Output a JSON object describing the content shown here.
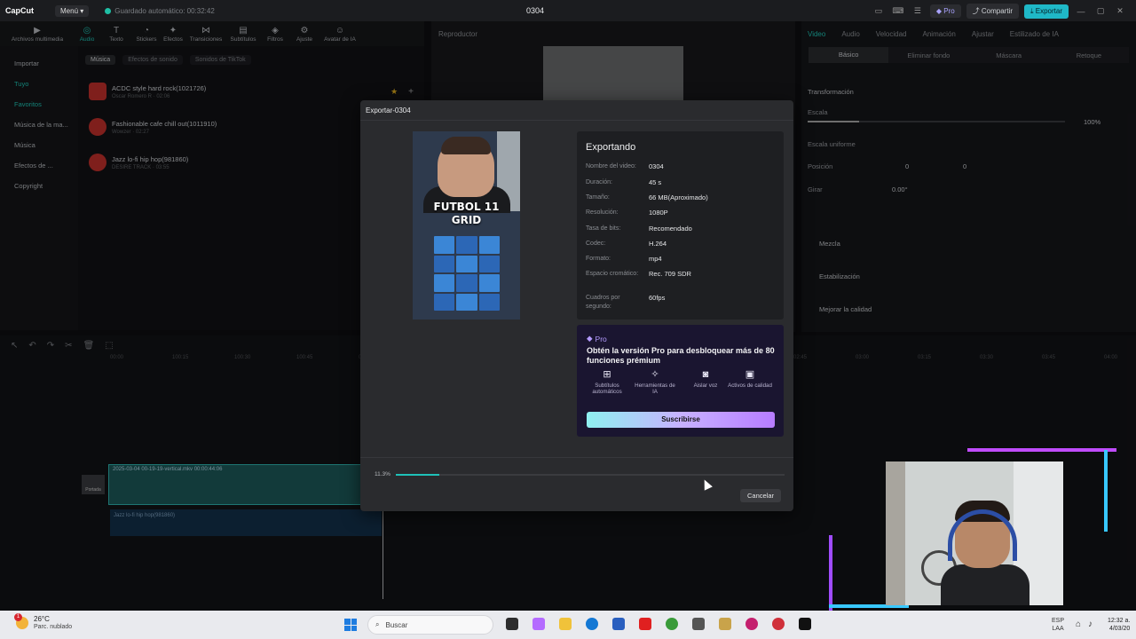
{
  "app": {
    "logo_text": "CapCut",
    "menu_label": "Menú",
    "autosave_text": "Guardado automático: 00:32:42",
    "project_title": "0304",
    "pro_label": "Pro",
    "share_label": "Compartir",
    "export_label": "Exportar"
  },
  "toolbar": {
    "items": [
      {
        "label": "Archivos multimedia",
        "icon": "media-icon"
      },
      {
        "label": "Audio",
        "icon": "audio-icon"
      },
      {
        "label": "Texto",
        "icon": "text-icon"
      },
      {
        "label": "Stickers",
        "icon": "sticker-icon"
      },
      {
        "label": "Efectos",
        "icon": "effects-icon"
      },
      {
        "label": "Transiciones",
        "icon": "transitions-icon"
      },
      {
        "label": "Subtítulos",
        "icon": "subtitles-icon"
      },
      {
        "label": "Filtros",
        "icon": "filters-icon"
      },
      {
        "label": "Ajuste",
        "icon": "adjust-icon"
      },
      {
        "label": "Avatar de IA",
        "icon": "avatar-icon"
      }
    ]
  },
  "left_panel": {
    "items": [
      "Importar",
      "Tuyo",
      "Favoritos",
      "Música de la ma...",
      "Música",
      "Efectos de ...",
      "Copyright"
    ]
  },
  "library": {
    "tabs": [
      "Música",
      "Efectos de sonido",
      "Sonidos de TikTok"
    ],
    "tracks": [
      {
        "name": "ACDC style hard rock(1021726)",
        "sub": "Oscar Romero R · 02:06"
      },
      {
        "name": "Fashionable cafe chill out(1011910)",
        "sub": "Wowzer · 02:27"
      },
      {
        "name": "Jazz lo-fi hip hop(981860)",
        "sub": "DESIRE TRACK · 03:55"
      }
    ]
  },
  "player": {
    "title": "Reproductor"
  },
  "inspector": {
    "tabs": [
      "Video",
      "Audio",
      "Velocidad",
      "Animación",
      "Ajustar",
      "Estilizado de IA"
    ],
    "subtabs": [
      "Básico",
      "Eliminar fondo",
      "Máscara",
      "Retoque"
    ],
    "transform_label": "Transformación",
    "scale_label": "Escala",
    "scale_value": "100%",
    "uniform_label": "Escala uniforme",
    "position_label": "Posición",
    "pos_x": "0",
    "pos_y": "0",
    "rotate_label": "Girar",
    "rotate_value": "0.00°",
    "blend_label": "Mezcla",
    "stabilize_label": "Estabilización",
    "enhance_label": "Mejorar la calidad"
  },
  "timeline": {
    "clip_label": "2025-03-04 00-19-19-vertical.mkv  00:00:44:06",
    "audio_label": "Jazz lo-fi hip hop(981860)",
    "cover_label": "Portada",
    "ruler": [
      "00:00",
      "100:15",
      "100:30",
      "100:45",
      "01:00",
      "01:15",
      "01:30",
      "01:45",
      "02:00",
      "02:15",
      "02:30",
      "02:45",
      "03:00",
      "03:15",
      "03:30",
      "03:45",
      "04:00"
    ]
  },
  "export_dialog": {
    "title": "Exportar-0304",
    "status_heading": "Exportando",
    "preview_headline_1": "FUTBOL 11",
    "preview_headline_2": "GRID",
    "fields": [
      {
        "label": "Nombre del video:",
        "value": "0304"
      },
      {
        "label": "Duración:",
        "value": "45 s"
      },
      {
        "label": "Tamaño:",
        "value": "66 MB(Aproximado)"
      },
      {
        "label": "Resolución:",
        "value": "1080P"
      },
      {
        "label": "Tasa de bits:",
        "value": "Recomendado"
      },
      {
        "label": "Codec:",
        "value": "H.264"
      },
      {
        "label": "Formato:",
        "value": "mp4"
      },
      {
        "label": "Espacio cromático:",
        "value": "Rec. 709 SDR"
      },
      {
        "label": "Cuadros por segundo:",
        "value": "60fps"
      }
    ],
    "pro": {
      "badge": "Pro",
      "message": "Obtén la versión Pro para desbloquear más de 80 funciones prémium",
      "features": [
        {
          "label": "Subtítulos automáticos",
          "icon": "subtitles-grid-icon"
        },
        {
          "label": "Herramientas de IA",
          "icon": "magic-wand-icon"
        },
        {
          "label": "Aislar voz",
          "icon": "voice-isolate-icon"
        },
        {
          "label": "Activos de calidad",
          "icon": "quality-assets-icon"
        }
      ],
      "subscribe_label": "Suscribirse"
    },
    "progress_text": "11.3%",
    "progress_value": 0.113,
    "cancel_label": "Cancelar"
  },
  "taskbar": {
    "weather_temp": "26°C",
    "weather_desc": "Parc. nublado",
    "weather_badge": "1",
    "search_placeholder": "Buscar",
    "lang_1": "ESP",
    "lang_2": "LAA",
    "time": "12:32 a.",
    "date": "4/03/20"
  },
  "colors": {
    "accent": "#1fc1b8",
    "pro_purple": "#b49bff",
    "dialog_bg": "#2a2b2e"
  }
}
